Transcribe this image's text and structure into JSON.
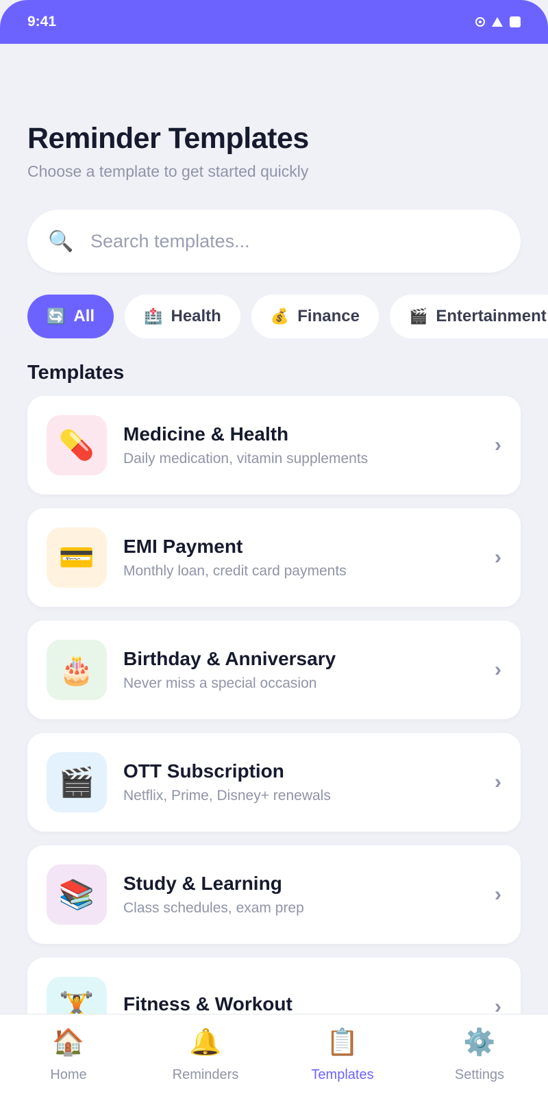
{
  "status_bar": {
    "time": "9:41"
  },
  "header": {
    "title": "Reminder Templates",
    "subtitle": "Choose a template to get started quickly"
  },
  "search": {
    "placeholder": "Search templates...",
    "value": ""
  },
  "chips": [
    {
      "icon": "🔄",
      "label": "All",
      "active": true
    },
    {
      "icon": "🏥",
      "label": "Health",
      "active": false
    },
    {
      "icon": "💰",
      "label": "Finance",
      "active": false
    },
    {
      "icon": "🎬",
      "label": "Entertainment",
      "active": false
    }
  ],
  "section_title": "Templates",
  "templates": [
    {
      "icon": "💊",
      "title": "Medicine & Health",
      "desc": "Daily medication, vitamin supplements",
      "tile_color": "#fde7ee"
    },
    {
      "icon": "💳",
      "title": "EMI Payment",
      "desc": "Monthly loan, credit card payments",
      "tile_color": "#fff3e0"
    },
    {
      "icon": "🎂",
      "title": "Birthday & Anniversary",
      "desc": "Never miss a special occasion",
      "tile_color": "#e8f5e9"
    },
    {
      "icon": "🎬",
      "title": "OTT Subscription",
      "desc": "Netflix, Prime, Disney+ renewals",
      "tile_color": "#e3f2fd"
    },
    {
      "icon": "📚",
      "title": "Study & Learning",
      "desc": "Class schedules, exam prep",
      "tile_color": "#f3e5f5"
    },
    {
      "icon": "🏋️",
      "title": "Fitness & Workout",
      "desc": "",
      "tile_color": "#e0f7fa"
    }
  ],
  "tabs": [
    {
      "icon": "🏠",
      "label": "Home",
      "active": false
    },
    {
      "icon": "🔔",
      "label": "Reminders",
      "active": false
    },
    {
      "icon": "📋",
      "label": "Templates",
      "active": true
    },
    {
      "icon": "⚙️",
      "label": "Settings",
      "active": false
    }
  ],
  "colors": {
    "accent": "#6c63ff",
    "background": "#f0f1f7",
    "text": "#161a2e",
    "muted": "#8f94a8"
  }
}
